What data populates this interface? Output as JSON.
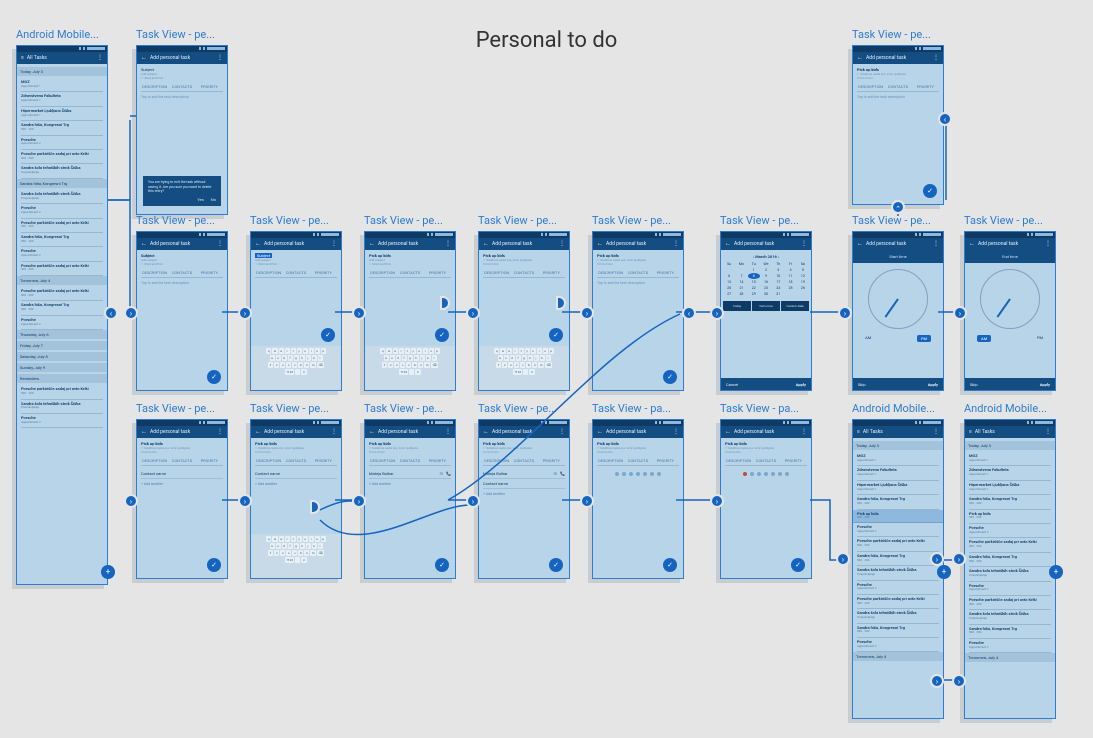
{
  "flow_title": "Personal to do",
  "labels": {
    "android_mobile": "Android Mobile...",
    "task_view_pe": "Task View - pe...",
    "task_view_pa": "Task View - pa..."
  },
  "appbars": {
    "all_tasks": "All Tasks",
    "add_personal": "Add personal task"
  },
  "tabs": {
    "description": "DESCRIPTION",
    "contacts": "CONTACTS",
    "priority": "PRIORITY"
  },
  "fields": {
    "subject": "Subject",
    "subject_hint": "Add subject",
    "start_end": "Start and End",
    "tap_desc": "Tap to add the task description",
    "pick_up_kids": "Pick up kids",
    "address": "Srednica cesta xyz, xnnn Ljubljana",
    "time_range": "9 min    0 min",
    "contact_name": "Contact name",
    "add_another": "+ Add another",
    "mateja": "Mateja  Bolhar",
    "phone_icon": "📞",
    "start_time": "Start time",
    "end_time": "End time",
    "am": "AM",
    "pm": "PM",
    "skip": "Skip",
    "apply": "Apply",
    "cancel": "Cancel",
    "today": "Today",
    "tomorrow": "Tomorrow",
    "custom": "Custom date"
  },
  "calendar": {
    "month": "March 2016",
    "dow": [
      "Su",
      "Mo",
      "Tu",
      "We",
      "Th",
      "Fr",
      "Sa"
    ],
    "weeks": [
      [
        "",
        "",
        "1",
        "2",
        "3",
        "4",
        "5"
      ],
      [
        "6",
        "7",
        "8",
        "9",
        "10",
        "11",
        "12"
      ],
      [
        "13",
        "14",
        "15",
        "16",
        "17",
        "18",
        "19"
      ],
      [
        "20",
        "21",
        "22",
        "23",
        "24",
        "25",
        "26"
      ],
      [
        "27",
        "28",
        "29",
        "30",
        "31",
        "",
        ""
      ]
    ],
    "selected": "8"
  },
  "dialog": {
    "text": "You are trying to exit the task without saving it. Are you sure you want to delete this entry?",
    "yes": "Yes",
    "no": "No"
  },
  "task_list": {
    "sections": [
      {
        "title": "Today, July 3",
        "items": [
          {
            "t": "MOZ",
            "s": "Appointment 1"
          },
          {
            "t": "Zdravstvena Fakulteta",
            "s": "Appointment 1"
          },
          {
            "t": "Hipermarket Ljubljana Šiška",
            "s": "Appointment 1"
          },
          {
            "t": "Sandra hiša, Kongresni Trg",
            "s": "500 · 200"
          },
          {
            "t": "Porsche",
            "s": "Appointment 2"
          },
          {
            "t": "Porsche parkirišče zadaj pri avto Kriki",
            "s": "500 · 200"
          },
          {
            "t": "Sandra šola tehniških strok Šiška",
            "s": "Pospravljanje"
          }
        ]
      },
      {
        "title": "Sandra hiša, Kongresni Trg",
        "items": [
          {
            "t": "Sandra šola tehniških strok Šiška",
            "s": "Pospravljanje"
          },
          {
            "t": "Porsche",
            "s": "Appointment 2"
          },
          {
            "t": "Porsche parkirišče zadaj pri avto Kriki",
            "s": "500 · 200"
          },
          {
            "t": "Sandra hiša, Kongresni Trg",
            "s": "500 · 200"
          },
          {
            "t": "Porsche",
            "s": "Appointment 2"
          },
          {
            "t": "Porsche parkirišče zadaj pri avto Kriki",
            "s": "500 · 200"
          }
        ]
      },
      {
        "title": "Tomorrow, July 4",
        "items": [
          {
            "t": "Porsche parkirišče zadaj pri avto Kriki",
            "s": "500 · 200"
          },
          {
            "t": "Sandra hiša, Kongresni Trg",
            "s": "500 · 200"
          },
          {
            "t": "Porsche",
            "s": "Appointment 2"
          }
        ]
      },
      {
        "title": "Thursday, July 6",
        "items": []
      },
      {
        "title": "Friday, July 7",
        "items": []
      },
      {
        "title": "Saturday, July 8",
        "items": []
      },
      {
        "title": "Sunday, July 9",
        "items": []
      },
      {
        "title": "Reminders",
        "items": [
          {
            "t": "Porsche parkirišče zadaj pri avto Kriki",
            "s": "500 · 200"
          },
          {
            "t": "Sandra šola tehniških strok Šiška",
            "s": "Pospravljanje"
          },
          {
            "t": "Porsche",
            "s": "Appointment 2"
          }
        ]
      }
    ]
  },
  "task_list_b": {
    "sections": [
      {
        "title": "Today, July 3",
        "items": [
          {
            "t": "MOZ",
            "s": "Appointment 1"
          },
          {
            "t": "Zdravstvena Fakulteta",
            "s": "Appointment 1"
          },
          {
            "t": "Hipermarket Ljubljana Šiška",
            "s": "Appointment 1"
          },
          {
            "t": "Sandra hiša, Kongresni Trg",
            "s": "500 · 200"
          },
          {
            "t": "Pick up kids",
            "s": "500 · 200",
            "hl": true
          },
          {
            "t": "Porsche",
            "s": "Appointment 2"
          },
          {
            "t": "Porsche parkirišče zadaj pri avto Kriki",
            "s": "500 · 200"
          },
          {
            "t": "Sandra hiša, Kongresni Trg",
            "s": "500 · 200"
          }
        ]
      },
      {
        "title": "",
        "items": [
          {
            "t": "Sandra šola tehniških strok Šiška",
            "s": "Pospravljanje"
          },
          {
            "t": "Porsche",
            "s": "Appointment 2"
          },
          {
            "t": "Porsche parkirišče zadaj pri avto Kriki",
            "s": "500 · 200"
          },
          {
            "t": "Sandra šola tehniških strok Šiška",
            "s": "Pospravljanje"
          },
          {
            "t": "Sandra hiša, Kongresni Trg",
            "s": "500 · 200"
          },
          {
            "t": "Porsche",
            "s": "Appointment 2"
          }
        ]
      },
      {
        "title": "Tomorrow, July 4",
        "items": []
      }
    ]
  },
  "keyboard": {
    "r1": [
      "q",
      "w",
      "e",
      "r",
      "t",
      "y",
      "u",
      "i",
      "o",
      "p"
    ],
    "r2": [
      "a",
      "s",
      "d",
      "f",
      "g",
      "h",
      "j",
      "k",
      "l"
    ],
    "r3": [
      "⇧",
      "z",
      "x",
      "c",
      "v",
      "b",
      "n",
      "m",
      "⌫"
    ],
    "r4": [
      "?123",
      "        ",
      "↵"
    ]
  }
}
